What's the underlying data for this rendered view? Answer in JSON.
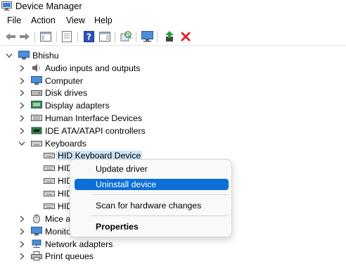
{
  "window": {
    "title": "Device Manager"
  },
  "menu": [
    "File",
    "Action",
    "View",
    "Help"
  ],
  "toolbar": {
    "buttons": [
      "back-arrow-icon",
      "forward-arrow-icon",
      "show-hide-console-tree-icon",
      "properties-sheet-icon",
      "help-icon",
      "action-pane-icon",
      "scan-hardware-icon",
      "monitor-icon",
      "update-driver-icon",
      "uninstall-x-icon"
    ],
    "accent_green": "#2e9a3e",
    "accent_red": "#d9262b"
  },
  "tree": {
    "root": "Bhishu",
    "categories": [
      "Audio inputs and outputs",
      "Computer",
      "Disk drives",
      "Display adapters",
      "Human Interface Devices",
      "IDE ATA/ATAPI controllers",
      "Keyboards",
      "Mice a",
      "Monito",
      "Network adapters",
      "Print queues"
    ],
    "keyboard_devices": [
      "HID Keyboard Device",
      "HID",
      "HID",
      "HID",
      "HID"
    ],
    "selected_color": "#cce4f7"
  },
  "context_menu": {
    "items": [
      "Update driver",
      "Uninstall device",
      "Scan for hardware changes",
      "Properties"
    ],
    "highlight_color": "#0d6ed6"
  }
}
